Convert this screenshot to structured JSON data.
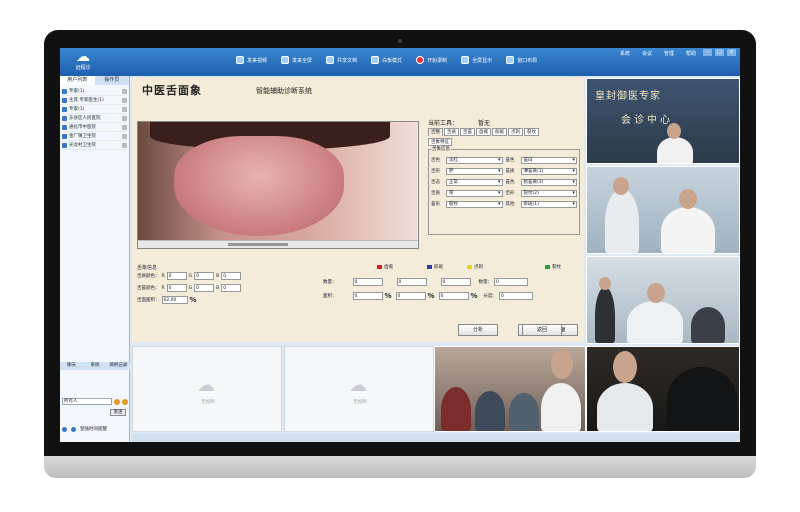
{
  "app": {
    "logo_text": "远程诊",
    "toolbar": [
      {
        "label": "发来视频",
        "icon": "microphone-icon"
      },
      {
        "label": "发来全屏",
        "icon": "screen-icon"
      },
      {
        "label": "共享文档",
        "icon": "document-icon"
      },
      {
        "label": "白板模式",
        "icon": "whiteboard-icon"
      },
      {
        "label": "开始录制",
        "icon": "record-icon"
      },
      {
        "label": "全屏显示",
        "icon": "fullscreen-icon"
      },
      {
        "label": "窗口布局",
        "icon": "layout-icon"
      }
    ],
    "window_menu": [
      "系统",
      "会议",
      "管理",
      "帮助"
    ],
    "window_buttons": [
      "–",
      "□",
      "×"
    ]
  },
  "sidebar": {
    "tabs": [
      "用户列表",
      "操作员"
    ],
    "items": [
      {
        "label": "专家(1)"
      },
      {
        "label": "主席 专家医生(1)"
      },
      {
        "label": "专家(1)"
      },
      {
        "label": "东县区人民医院"
      },
      {
        "label": "通化市中医院"
      },
      {
        "label": "金厂镇卫生院"
      },
      {
        "label": "光龙村卫生院"
      }
    ],
    "bottom_tabs": [
      "聊天",
      "系统",
      "病例记录"
    ],
    "recipient": "所有人",
    "send_label": "发送",
    "footer_label": "登陆时间提醒"
  },
  "diagnosis": {
    "title": "中医舌面象",
    "subtitle": "智能辅助诊断系统",
    "current_tool_label": "当前工具：",
    "current_tool_value": "暂无",
    "tool_tabs": [
      "舌整",
      "舌质",
      "舌苔",
      "齿痕",
      "瘀斑",
      "点刺",
      "裂纹"
    ],
    "sub_tab": "舌象特征",
    "feature_box_title": "舌象信息",
    "features": [
      {
        "label": "舌色",
        "value": "淡红",
        "label2": "苔色",
        "value2": "苔白"
      },
      {
        "label": "舌形",
        "value": "胖",
        "label2": "苔质",
        "value2": "薄苔黄(1)"
      },
      {
        "label": "舌态",
        "value": "正常",
        "label2": "苔色",
        "value2": "腻苔黄(3)"
      },
      {
        "label": "舌质",
        "value": "厚",
        "label2": "舌形",
        "value2": "裂纹(2)"
      },
      {
        "label": "苔形",
        "value": "裂纹",
        "label2": "其他",
        "value2": "瘀斑(1)"
      }
    ],
    "measure_title": "舌象信息",
    "color_tongue_label": "舌质颜色：",
    "color_coating_label": "舌苔颜色：",
    "area_label": "舌面面积：",
    "area_value": "62.00",
    "pct_symbol": "%",
    "r_label": "R",
    "g_label": "G",
    "b_label": "B",
    "rgb_values": {
      "r1": "0",
      "g1": "0",
      "b1": "0",
      "r2": "0",
      "g2": "0",
      "b2": "0"
    },
    "legend": [
      {
        "label": "齿痕",
        "color": "#d42020"
      },
      {
        "label": "瘀斑",
        "color": "#2a3f9b"
      },
      {
        "label": "点刺",
        "color": "#e8d21a"
      },
      {
        "label": "裂纹",
        "color": "#2f9b3a"
      }
    ],
    "count_label": "数量：",
    "area2_label": "面积：",
    "length_label": "长度：",
    "count_values": [
      "0",
      "0",
      "0",
      "0"
    ],
    "area_values": [
      "0",
      "0",
      "0",
      "0"
    ],
    "buttons": {
      "analyze": "分析",
      "back_to_capture": "返回到打印界面",
      "back": "返回"
    }
  },
  "video_panels": {
    "banner_line1": "皇封御医专家",
    "banner_line2": "会诊中心",
    "empty_label": "无视频"
  }
}
